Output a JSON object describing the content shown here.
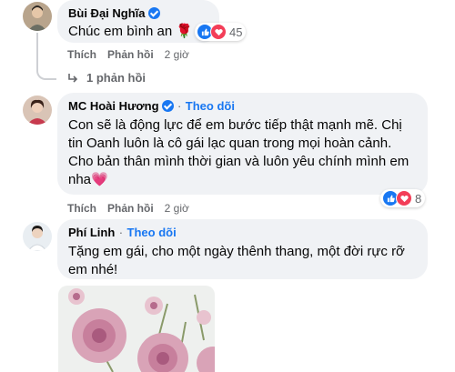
{
  "comments": [
    {
      "name": "Bùi Đại Nghĩa",
      "text": "Chúc em bình an 🌹",
      "reaction_count": "45",
      "actions": {
        "like": "Thích",
        "reply": "Phản hồi",
        "time": "2 giờ"
      },
      "replies_link": "1 phản hồi"
    },
    {
      "name": "MC Hoài Hương",
      "dot": "·",
      "follow": "Theo dõi",
      "text_lines": [
        "Con sẽ là động lực để em bước tiếp thật mạnh mẽ. Chị",
        "tin Oanh luôn là cô gái lạc quan trong mọi hoàn cảnh.",
        "Cho bản thân mình thời gian và luôn yêu chính mình em",
        "nha💗"
      ],
      "reaction_count": "8",
      "actions": {
        "like": "Thích",
        "reply": "Phản hồi",
        "time": "2 giờ"
      }
    },
    {
      "name": "Phí Linh",
      "dot": "·",
      "follow": "Theo dõi",
      "text_lines": [
        "Tặng em gái, cho một ngày thênh thang, một đời rực rỡ",
        "em nhé!"
      ]
    }
  ],
  "colors": {
    "bubble": "#f0f2f5",
    "accent": "#1877f2",
    "love": "#f33e58",
    "muted": "#65676b"
  },
  "icons": {
    "like": "thumbs-up",
    "love": "heart",
    "verified": "check-badge",
    "reply-arrow": "reply-arrow"
  }
}
